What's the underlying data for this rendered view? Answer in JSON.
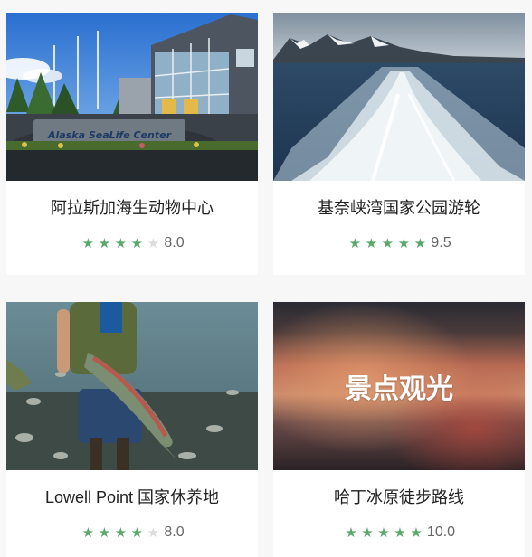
{
  "cards": [
    {
      "title": "阿拉斯加海生动物中心",
      "rating": 4,
      "score": "8.0",
      "image": "aquarium-building-photo",
      "sign_text": "Alaska SeaLife Center"
    },
    {
      "title": "基奈峡湾国家公园游轮",
      "rating": 5,
      "score": "9.5",
      "image": "boat-wake-fjord-photo"
    },
    {
      "title": "Lowell Point 国家休养地",
      "rating": 4,
      "score": "8.0",
      "image": "fisherman-salmon-photo"
    },
    {
      "title": "哈丁冰原徒步路线",
      "rating": 5,
      "score": "10.0",
      "image": "blurred-sunset-placeholder",
      "overlay_label": "景点观光"
    }
  ],
  "colors": {
    "star_on": "#5aa96b",
    "star_off": "#dcdcdc",
    "page_bg": "#f7f7f7"
  }
}
